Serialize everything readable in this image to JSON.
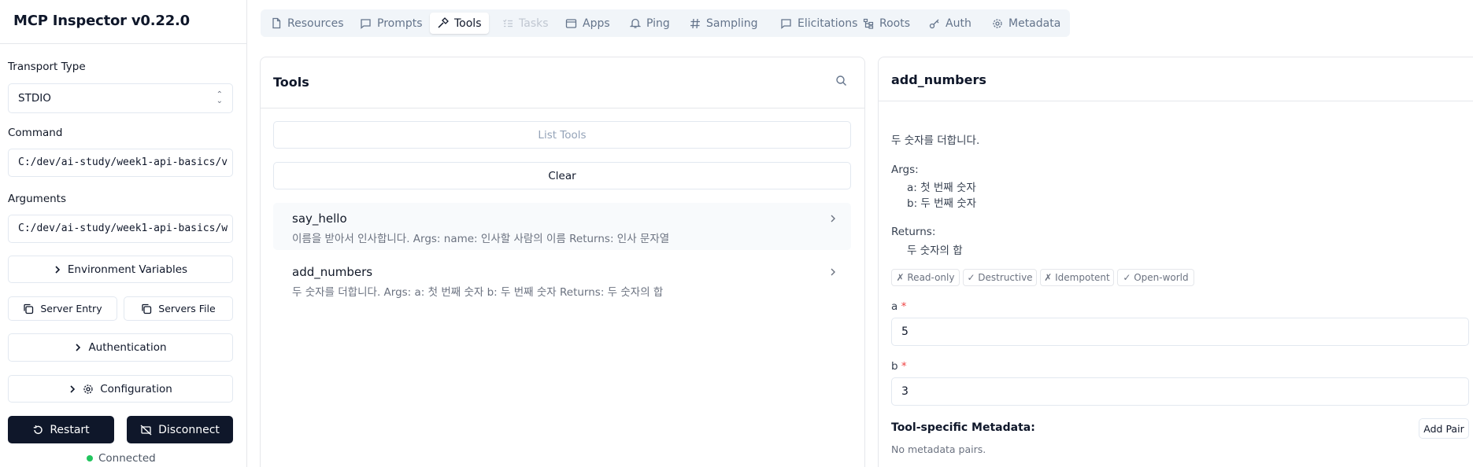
{
  "app": {
    "title": "MCP Inspector v0.22.0"
  },
  "sidebar": {
    "transport_label": "Transport Type",
    "transport_value": "STDIO",
    "command_label": "Command",
    "command_value": "C:/dev/ai-study/week1-api-basics/v",
    "arguments_label": "Arguments",
    "arguments_value": "C:/dev/ai-study/week1-api-basics/w",
    "env_button": "Environment Variables",
    "server_entry_button": "Server Entry",
    "servers_file_button": "Servers File",
    "auth_button": "Authentication",
    "config_button": "Configuration",
    "restart_button": "Restart",
    "disconnect_button": "Disconnect",
    "status": "Connected",
    "status_color": "#22c55e"
  },
  "tabs": [
    {
      "label": "Resources",
      "icon": "file-icon",
      "state": "normal"
    },
    {
      "label": "Prompts",
      "icon": "message-square-icon",
      "state": "normal"
    },
    {
      "label": "Tools",
      "icon": "hammer-icon",
      "state": "active"
    },
    {
      "label": "Tasks",
      "icon": "list-todo-icon",
      "state": "disabled"
    },
    {
      "label": "Apps",
      "icon": "app-window-icon",
      "state": "normal"
    },
    {
      "label": "Ping",
      "icon": "bell-icon",
      "state": "normal"
    },
    {
      "label": "Sampling",
      "icon": "hash-icon",
      "state": "normal"
    },
    {
      "label": "Elicitations",
      "icon": "message-square-icon",
      "state": "normal"
    },
    {
      "label": "Roots",
      "icon": "folder-tree-icon",
      "state": "normal"
    },
    {
      "label": "Auth",
      "icon": "key-icon",
      "state": "normal"
    },
    {
      "label": "Metadata",
      "icon": "gear-icon",
      "state": "normal"
    }
  ],
  "tools_panel": {
    "title": "Tools",
    "list_button": "List Tools",
    "clear_button": "Clear",
    "items": [
      {
        "name": "say_hello",
        "description": "이름을 받아서 인사합니다. Args: name: 인사할 사람의 이름 Returns: 인사 문자열"
      },
      {
        "name": "add_numbers",
        "description": "두 숫자를 더합니다. Args: a: 첫 번째 숫자 b: 두 번째 숫자 Returns: 두 숫자의 합"
      }
    ]
  },
  "detail": {
    "title": "add_numbers",
    "summary": "두 숫자를 더합니다.",
    "args_label": "Args:",
    "arg_a": "a: 첫 번째 숫자",
    "arg_b": "b: 두 번째 숫자",
    "returns_label": "Returns:",
    "returns_value": "두 숫자의 합",
    "badges": [
      "✗ Read-only",
      "✓ Destructive",
      "✗ Idempotent",
      "✓ Open-world"
    ],
    "field_a_label": "a",
    "field_a_value": "5",
    "field_b_label": "b",
    "field_b_value": "3",
    "required_mark": "*",
    "metadata_title": "Tool-specific Metadata:",
    "add_pair_button": "Add Pair",
    "no_metadata": "No metadata pairs."
  }
}
